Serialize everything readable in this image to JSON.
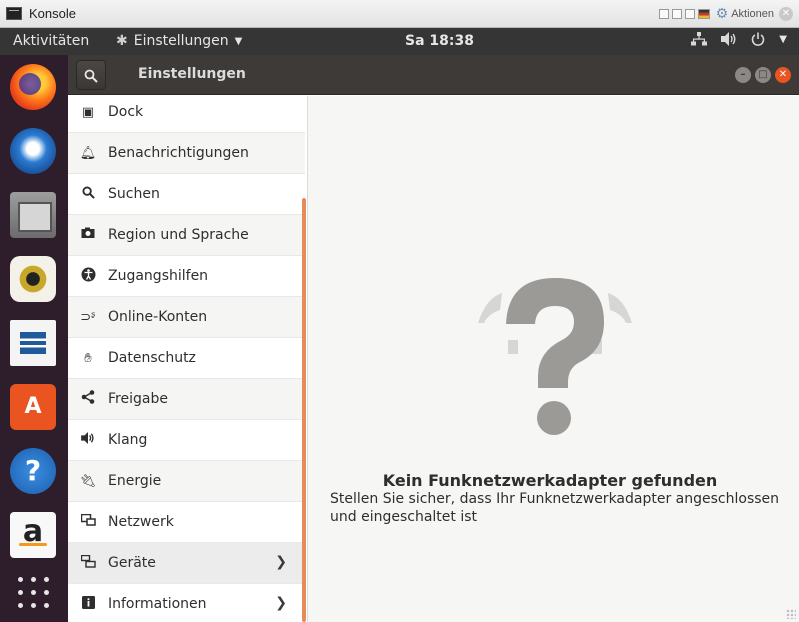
{
  "host_window": {
    "title": "Konsole",
    "actions_label": "Aktionen"
  },
  "top_panel": {
    "activities": "Aktivitäten",
    "app_menu": "Einstellungen",
    "clock": "Sa 18:38"
  },
  "dock": {
    "items": [
      "firefox-icon",
      "thunderbird-icon",
      "files-icon",
      "rhythmbox-icon",
      "libreoffice-writer-icon",
      "ubuntu-software-icon",
      "help-icon",
      "amazon-icon",
      "show-applications-icon"
    ]
  },
  "settings": {
    "header_title": "Einstellungen",
    "sidebar": [
      {
        "label": "Dock",
        "icon": "dock-icon"
      },
      {
        "label": "Benachrichtigungen",
        "icon": "bell-icon"
      },
      {
        "label": "Suchen",
        "icon": "search-icon"
      },
      {
        "label": "Region und Sprache",
        "icon": "camera-icon"
      },
      {
        "label": "Zugangshilfen",
        "icon": "accessibility-icon"
      },
      {
        "label": "Online-Konten",
        "icon": "online-accounts-icon"
      },
      {
        "label": "Datenschutz",
        "icon": "hand-icon"
      },
      {
        "label": "Freigabe",
        "icon": "share-icon"
      },
      {
        "label": "Klang",
        "icon": "speaker-icon"
      },
      {
        "label": "Energie",
        "icon": "power-plug-icon"
      },
      {
        "label": "Netzwerk",
        "icon": "network-icon"
      },
      {
        "label": "Geräte",
        "icon": "devices-icon"
      },
      {
        "label": "Informationen",
        "icon": "info-icon"
      }
    ],
    "message_title": "Kein Funknetzwerkadapter gefunden",
    "message_body": "Stellen Sie sicher, dass Ihr Funknetzwerkadapter angeschlossen und eingeschaltet ist"
  },
  "colors": {
    "accent": "#e95420",
    "panel": "#353535",
    "dock": "#2e1d2b",
    "headerbar": "#3d3a38"
  }
}
